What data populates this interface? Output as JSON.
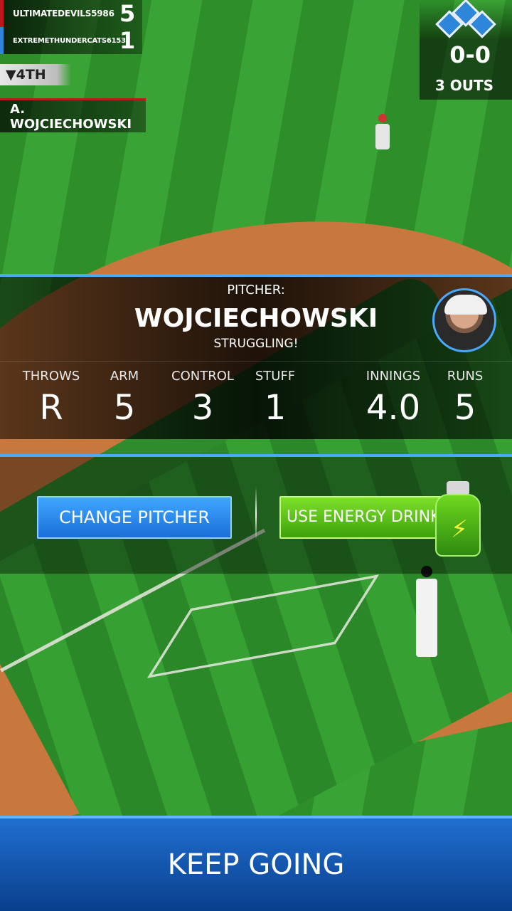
{
  "scoreboard": {
    "teams": [
      {
        "name": "ULTIMATEDEVILS5986",
        "score": "5",
        "color": "#c0161e"
      },
      {
        "name": "EXTREMETHUNDERCATS6153",
        "score": "1",
        "color": "#2d86d9"
      }
    ],
    "inning": "▼4TH",
    "batter": "A. WOJCIECHOWSKI",
    "count": "0-0",
    "outs": "3 OUTS"
  },
  "pitcher": {
    "label": "PITCHER:",
    "name": "WOJCIECHOWSKI",
    "status": "STRUGGLING!",
    "stats": [
      {
        "label": "THROWS",
        "value": "R"
      },
      {
        "label": "ARM",
        "value": "5"
      },
      {
        "label": "CONTROL",
        "value": "3"
      },
      {
        "label": "STUFF",
        "value": "1"
      },
      {
        "label": "INNINGS",
        "value": "4.0"
      },
      {
        "label": "RUNS",
        "value": "5"
      }
    ]
  },
  "actions": {
    "change_pitcher": "CHANGE PITCHER",
    "energy_drink": "USE ENERGY DRINK"
  },
  "footer": {
    "keep_going": "KEEP GOING"
  },
  "colors": {
    "accent_blue": "#49a9ff",
    "button_blue": "#1a6fd8",
    "button_green": "#3da20c",
    "home_red": "#c0161e"
  }
}
